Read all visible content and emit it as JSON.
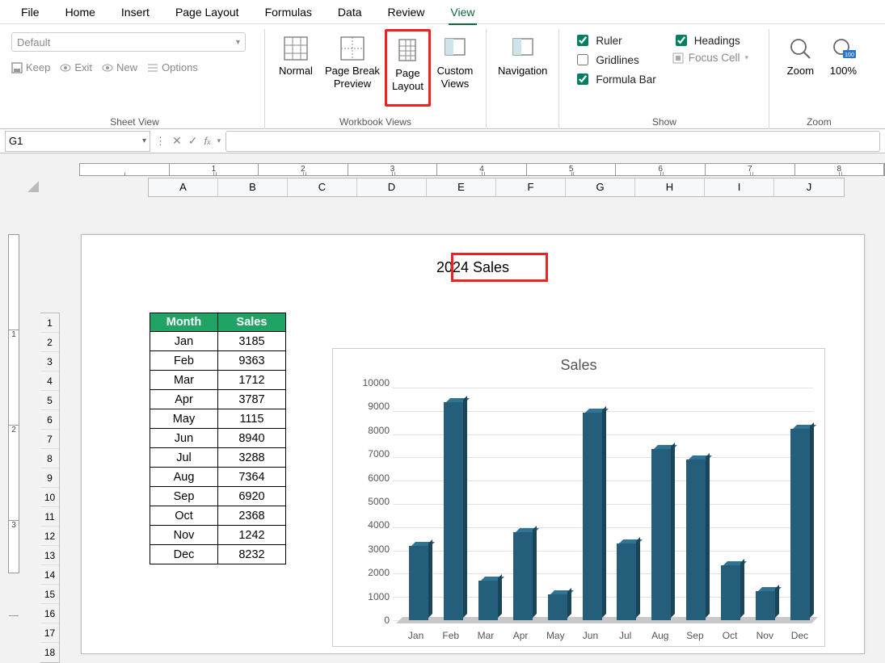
{
  "menu": [
    "File",
    "Home",
    "Insert",
    "Page Layout",
    "Formulas",
    "Data",
    "Review",
    "View"
  ],
  "active_menu": "View",
  "ribbon": {
    "sheet_view": {
      "dropdown": "Default",
      "keep": "Keep",
      "exit": "Exit",
      "new": "New",
      "options": "Options",
      "group": "Sheet View"
    },
    "workbook_views": {
      "normal": "Normal",
      "page_break_a": "Page Break",
      "page_break_b": "Preview",
      "page_layout_a": "Page",
      "page_layout_b": "Layout",
      "custom_a": "Custom",
      "custom_b": "Views",
      "group": "Workbook Views"
    },
    "nav": {
      "label": "Navigation"
    },
    "show": {
      "ruler": "Ruler",
      "gridlines": "Gridlines",
      "formula_bar": "Formula Bar",
      "headings": "Headings",
      "focus_cell": "Focus Cell",
      "group": "Show"
    },
    "zoom": {
      "zoom": "Zoom",
      "hundred": "100%",
      "group": "Zoom"
    }
  },
  "namebox": "G1",
  "columns": [
    "A",
    "B",
    "C",
    "D",
    "E",
    "F",
    "G",
    "H",
    "I",
    "J"
  ],
  "rows": [
    "1",
    "2",
    "3",
    "4",
    "5",
    "6",
    "7",
    "8",
    "9",
    "10",
    "11",
    "12",
    "13",
    "14",
    "15",
    "16",
    "17",
    "18"
  ],
  "header_text": "2024 Sales",
  "table": {
    "headers": {
      "month": "Month",
      "sales": "Sales"
    },
    "rows": [
      {
        "m": "Jan",
        "s": 3185
      },
      {
        "m": "Feb",
        "s": 9363
      },
      {
        "m": "Mar",
        "s": 1712
      },
      {
        "m": "Apr",
        "s": 3787
      },
      {
        "m": "May",
        "s": 1115
      },
      {
        "m": "Jun",
        "s": 8940
      },
      {
        "m": "Jul",
        "s": 3288
      },
      {
        "m": "Aug",
        "s": 7364
      },
      {
        "m": "Sep",
        "s": 6920
      },
      {
        "m": "Oct",
        "s": 2368
      },
      {
        "m": "Nov",
        "s": 1242
      },
      {
        "m": "Dec",
        "s": 8232
      }
    ]
  },
  "chart_data": {
    "type": "bar",
    "title": "Sales",
    "categories": [
      "Jan",
      "Feb",
      "Mar",
      "Apr",
      "May",
      "Jun",
      "Jul",
      "Aug",
      "Sep",
      "Oct",
      "Nov",
      "Dec"
    ],
    "values": [
      3185,
      9363,
      1712,
      3787,
      1115,
      8940,
      3288,
      7364,
      6920,
      2368,
      1242,
      8232
    ],
    "ylim": [
      0,
      10000
    ],
    "yticks": [
      0,
      1000,
      2000,
      3000,
      4000,
      5000,
      6000,
      7000,
      8000,
      9000,
      10000
    ],
    "xlabel": "",
    "ylabel": ""
  },
  "ruler_inches": [
    "",
    "1",
    "2",
    "3",
    "4",
    "5",
    "6",
    "7",
    "8"
  ],
  "v_ruler_inches": [
    "",
    "1",
    "2",
    "3"
  ]
}
